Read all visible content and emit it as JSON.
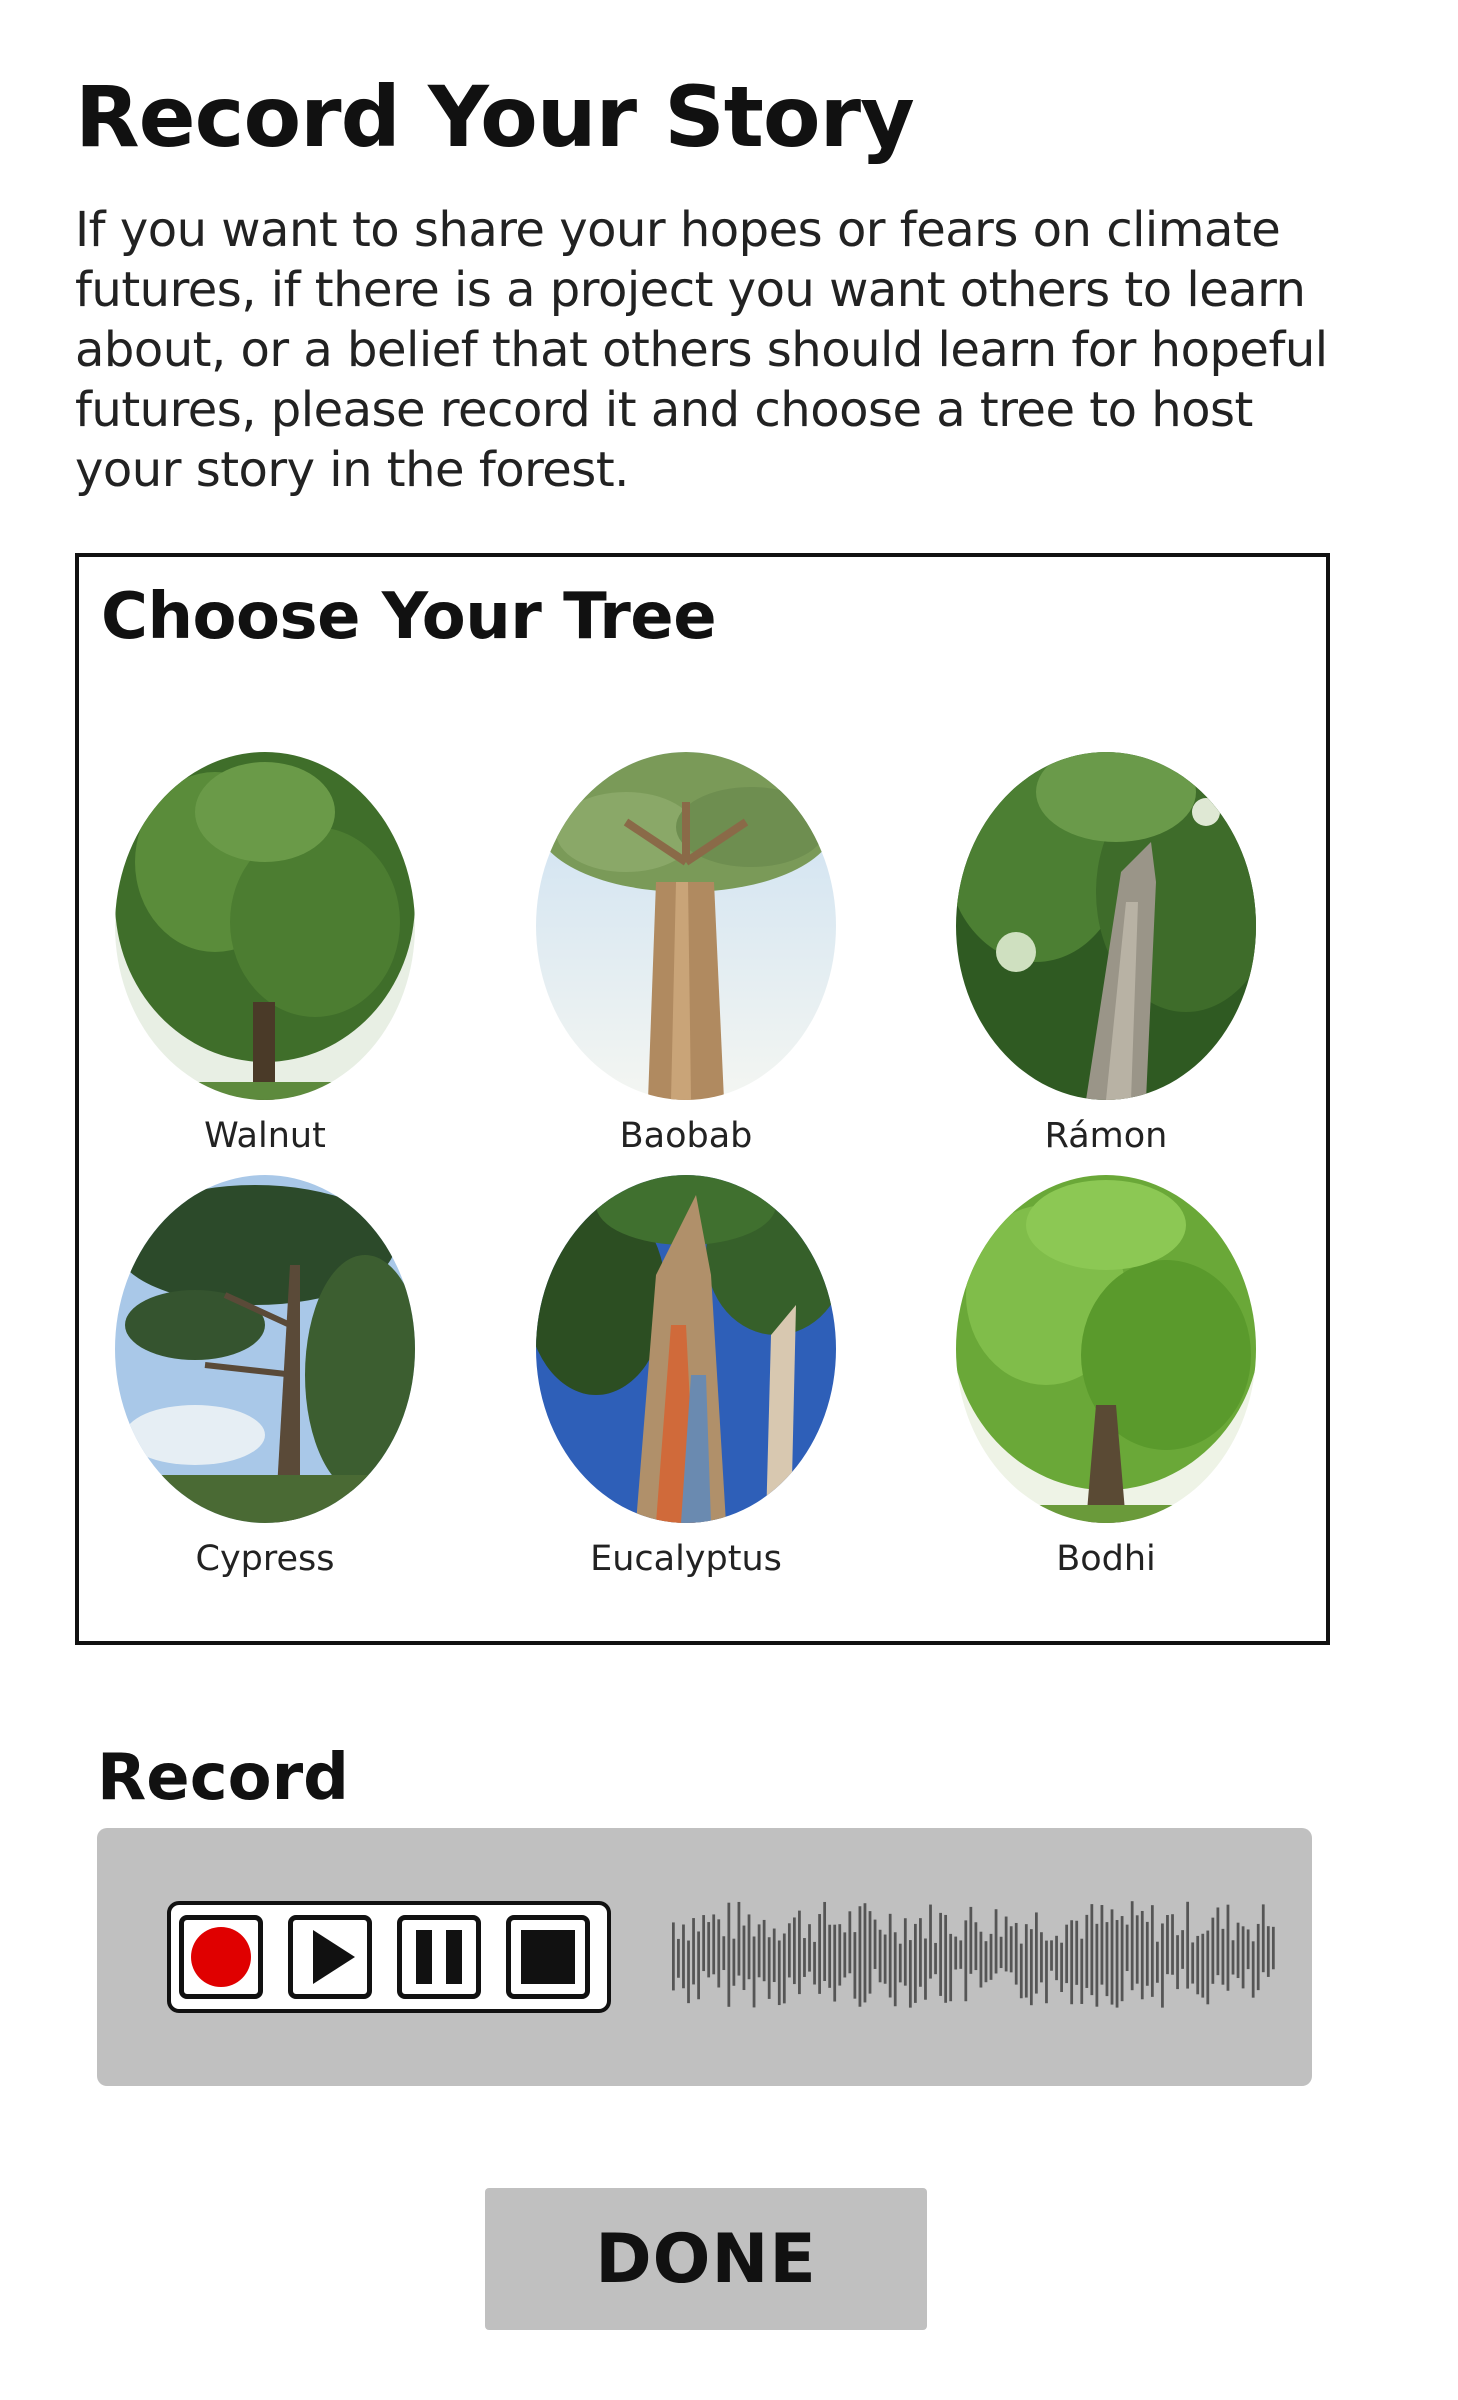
{
  "page": {
    "title": "Record Your Story",
    "intro": "If you want to share your hopes or fears on climate futures, if there is a project you want others to learn about, or a belief that others should learn for hopeful futures, please record it and choose a tree to host your story in the forest."
  },
  "tree_picker": {
    "title": "Choose Your Tree",
    "trees": [
      {
        "label": "Walnut"
      },
      {
        "label": "Baobab"
      },
      {
        "label": "Rámon"
      },
      {
        "label": "Cypress"
      },
      {
        "label": "Eucalyptus"
      },
      {
        "label": "Bodhi"
      }
    ]
  },
  "recorder": {
    "title": "Record",
    "controls": [
      "record-icon",
      "play-icon",
      "pause-icon",
      "stop-icon"
    ],
    "colors": {
      "panel": "#c0c0c0",
      "record_dot": "#e00000",
      "waveform": "#555555"
    }
  },
  "actions": {
    "done_label": "DONE"
  }
}
